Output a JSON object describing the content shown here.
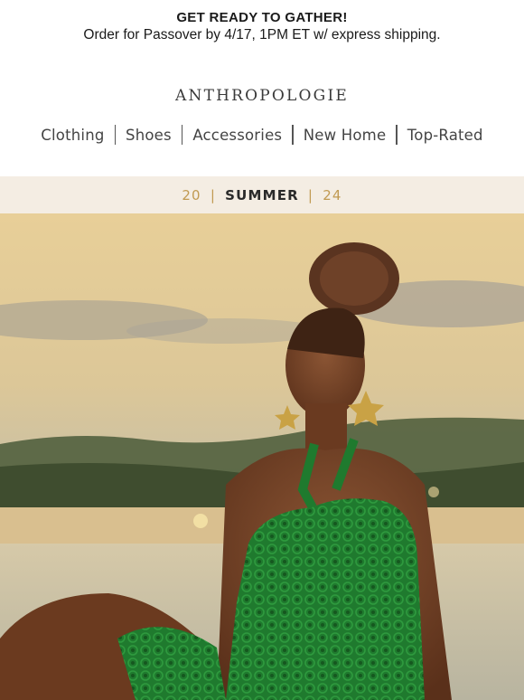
{
  "promo": {
    "title": "GET READY TO GATHER!",
    "subtitle": "Order for Passover by 4/17, 1PM ET w/ express shipping."
  },
  "brand": {
    "logo_text": "ANTHROPOLOGIE"
  },
  "nav": {
    "items": [
      {
        "label": "Clothing"
      },
      {
        "label": "Shoes"
      },
      {
        "label": "Accessories"
      },
      {
        "label": "New Home"
      },
      {
        "label": "Top-Rated"
      }
    ]
  },
  "season_band": {
    "year_left": "20",
    "season": "SUMMER",
    "year_right": "24",
    "accent_color": "#c19a52",
    "background_color": "#f4ede3"
  },
  "hero": {
    "image_subject": "model in green crochet halter top seated by the sea at sunset"
  }
}
